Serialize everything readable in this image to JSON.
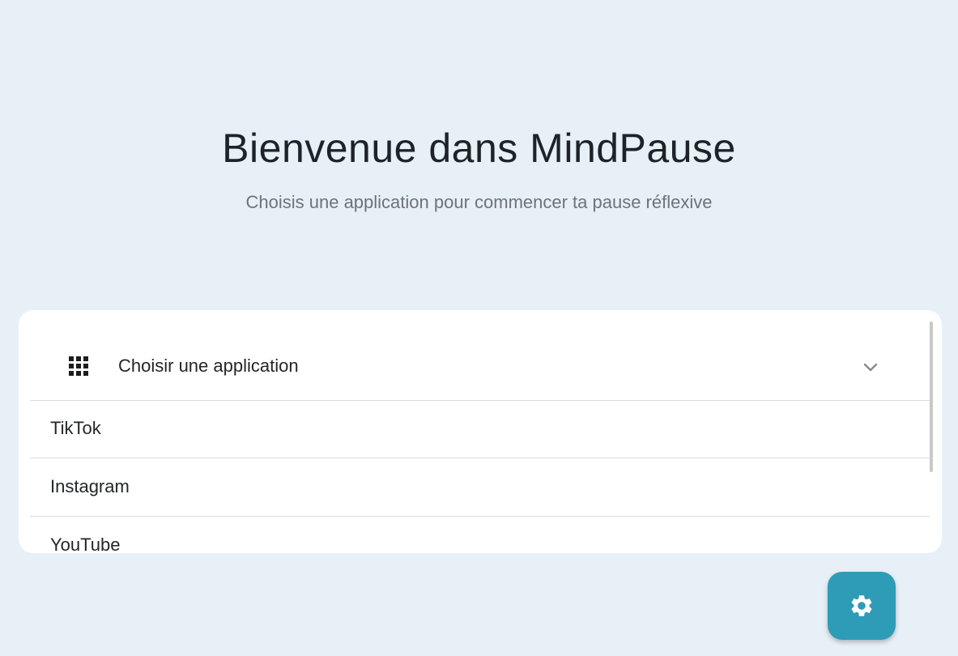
{
  "header": {
    "title": "Bienvenue dans MindPause",
    "subtitle": "Choisis une application pour commencer ta pause réflexive"
  },
  "app_selector": {
    "label": "Choisir une application",
    "icon": "grid-icon",
    "expand_icon": "chevron-down-icon",
    "options": [
      "TikTok",
      "Instagram",
      "YouTube"
    ]
  },
  "fab": {
    "icon": "gear-icon"
  },
  "colors": {
    "background": "#e8f0f7",
    "card": "#ffffff",
    "accent": "#2e9cb6",
    "title_text": "#1d2329",
    "subtitle_text": "#6d7379"
  }
}
